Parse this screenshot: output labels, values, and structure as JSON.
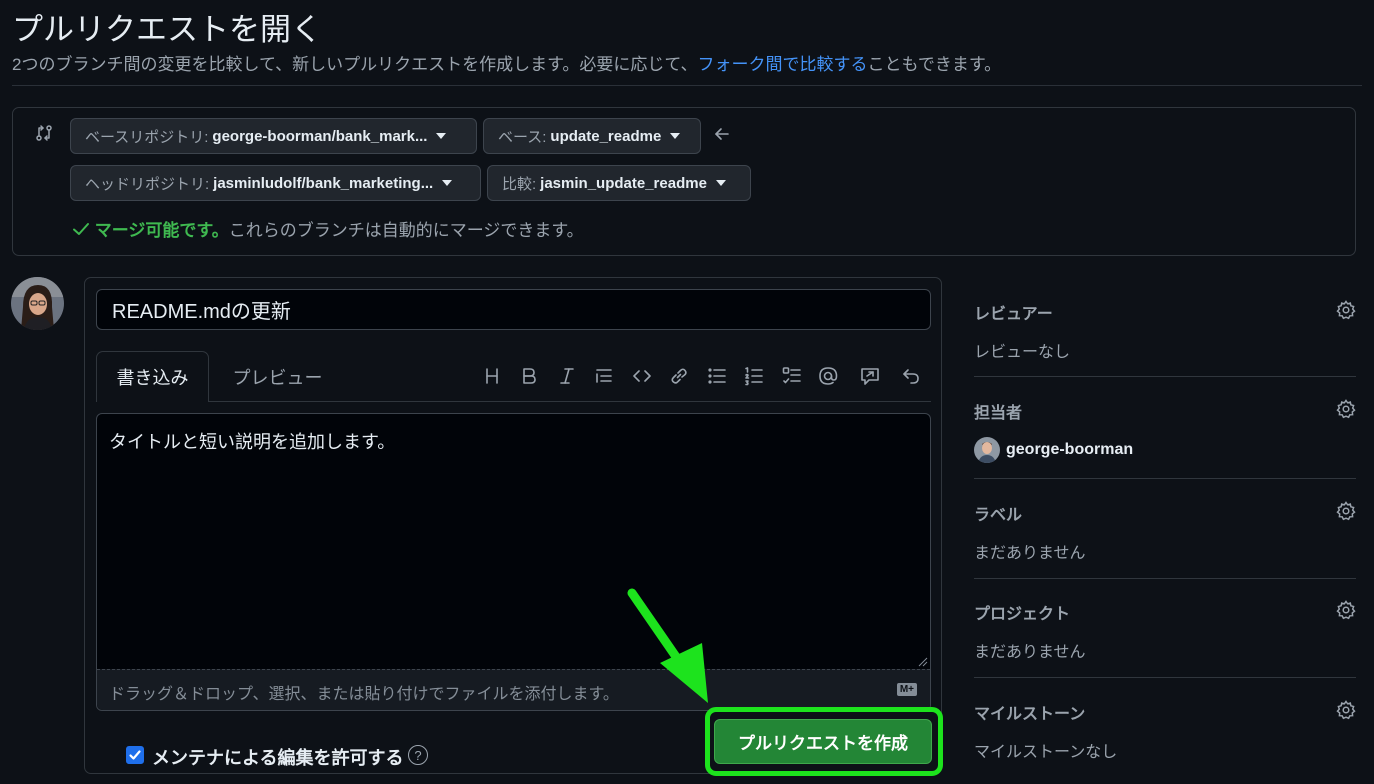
{
  "header": {
    "title": "プルリクエストを開く",
    "subtitle_before": "2つのブランチ間の変更を比較して、新しいプルリクエストを作成します。必要に応じて、",
    "subtitle_link": "フォーク間で比較する",
    "subtitle_after": "こともできます。"
  },
  "compare": {
    "base_repo_label": "ベースリポジトリ:",
    "base_repo_value": "george-boorman/bank_mark...",
    "base_label": "ベース:",
    "base_value": "update_readme",
    "head_repo_label": "ヘッドリポジトリ:",
    "head_repo_value": "jasminludolf/bank_marketing...",
    "compare_label": "比較:",
    "compare_value": "jasmin_update_readme",
    "merge_ok": "マージ可能です。",
    "merge_desc": "これらのブランチは自動的にマージできます。"
  },
  "editor": {
    "title_value": "README.mdの更新",
    "tab_write": "書き込み",
    "tab_preview": "プレビュー",
    "body_text": "タイトルと短い説明を追加します。",
    "drop_hint": "ドラッグ＆ドロップ、選択、または貼り付けでファイルを添付します。",
    "markdown_badge": "M+",
    "toolbar_icons": [
      "heading-icon",
      "bold-icon",
      "italic-icon",
      "quote-icon",
      "code-icon",
      "link-icon",
      "unordered-list-icon",
      "ordered-list-icon",
      "task-list-icon",
      "mention-icon",
      "reference-icon",
      "undo-icon"
    ]
  },
  "footer": {
    "allow_edits_label": "メンテナによる編集を許可する",
    "help": "?",
    "create_button": "プルリクエストを作成"
  },
  "sidebar": {
    "reviewers_title": "レビュアー",
    "reviewers_value": "レビューなし",
    "assignees_title": "担当者",
    "assignee_name": "george-boorman",
    "labels_title": "ラベル",
    "labels_value": "まだありません",
    "projects_title": "プロジェクト",
    "projects_value": "まだありません",
    "milestone_title": "マイルストーン",
    "milestone_value": "マイルストーンなし"
  },
  "colors": {
    "background": "#0d1117",
    "link": "#4493f8",
    "success": "#3fb950",
    "primary_button": "#238636",
    "highlight": "#1de31d"
  }
}
